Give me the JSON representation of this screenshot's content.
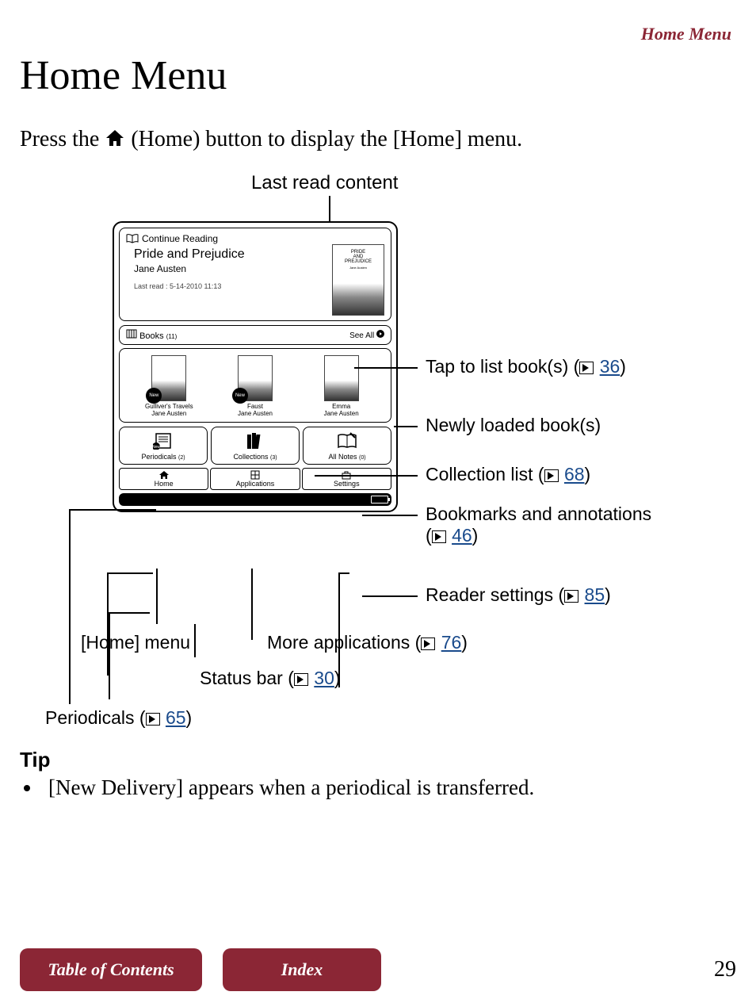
{
  "header": {
    "section": "Home Menu"
  },
  "title": "Home Menu",
  "intro": {
    "p1": "Press the ",
    "p2": " (Home) button to display the [Home] menu."
  },
  "diagram": {
    "top_label": "Last read content",
    "device": {
      "continue_reading": {
        "header": "Continue Reading",
        "title": "Pride and Prejudice",
        "author": "Jane Austen",
        "last_read_label": "Last read : 5-14-2010 11:13",
        "cover": {
          "line1": "PRIDE",
          "line2": "AND",
          "line3": "PREJUDICE",
          "author": "Jane Austen"
        }
      },
      "books": {
        "label": "Books",
        "count": "(11)",
        "see_all": "See All",
        "items": [
          {
            "title": "Gulliver's Travels",
            "author": "Jane Austen",
            "new": true
          },
          {
            "title": "Faust",
            "author": "Jane Austen",
            "new": true
          },
          {
            "title": "Emma",
            "author": "Jane Austen",
            "new": false
          }
        ]
      },
      "tiles": {
        "periodicals": {
          "label": "Periodicals",
          "count": "(2)"
        },
        "collections": {
          "label": "Collections",
          "count": "(3)"
        },
        "all_notes": {
          "label": "All Notes",
          "count": "(0)"
        }
      },
      "nav": {
        "home": "Home",
        "applications": "Applications",
        "settings": "Settings"
      }
    },
    "callouts": {
      "tap_books": {
        "text": "Tap to list book(s) (",
        "page": "36",
        "close": ")"
      },
      "newly_loaded": "Newly loaded book(s)",
      "collection_list": {
        "text": "Collection list (",
        "page": "68",
        "close": ")"
      },
      "bookmarks": {
        "text": "Bookmarks and annotations",
        "open": "(",
        "page": "46",
        "close": ")"
      },
      "reader_settings": {
        "text": "Reader settings (",
        "page": "85",
        "close": ")"
      },
      "home_menu": "[Home] menu",
      "more_apps": {
        "text": "More applications (",
        "page": "76",
        "close": ")"
      },
      "status_bar": {
        "text": "Status bar (",
        "page": "30",
        "close": ")"
      },
      "periodicals": {
        "text": "Periodicals (",
        "page": "65",
        "close": ")"
      }
    }
  },
  "tip": {
    "heading": "Tip",
    "item1": "[New Delivery] appears when a periodical is transferred."
  },
  "footer": {
    "toc": "Table of Contents",
    "index": "Index",
    "page": "29"
  }
}
